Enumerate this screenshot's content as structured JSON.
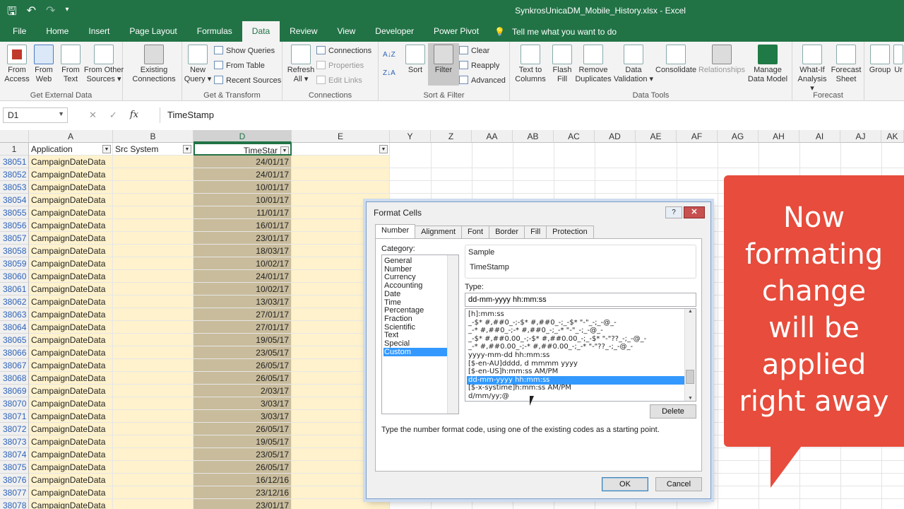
{
  "window": {
    "title": "SynkrosUnicaDM_Mobile_History.xlsx  -  Excel"
  },
  "menu": {
    "tabs": [
      "File",
      "Home",
      "Insert",
      "Page Layout",
      "Formulas",
      "Data",
      "Review",
      "View",
      "Developer",
      "Power Pivot"
    ],
    "active": "Data",
    "tell_me": "Tell me what you want to do"
  },
  "ribbon": {
    "get_external": {
      "label": "Get External Data",
      "from_access": [
        "From",
        "Access"
      ],
      "from_web": [
        "From",
        "Web"
      ],
      "from_text": [
        "From",
        "Text"
      ],
      "from_other": [
        "From Other",
        "Sources ▾"
      ],
      "existing": [
        "Existing",
        "Connections"
      ]
    },
    "get_transform": {
      "label": "Get & Transform",
      "new_query": [
        "New",
        "Query ▾"
      ],
      "show_queries": "Show Queries",
      "from_table": "From Table",
      "recent_sources": "Recent Sources"
    },
    "connections": {
      "label": "Connections",
      "refresh": [
        "Refresh",
        "All ▾"
      ],
      "connections": "Connections",
      "properties": "Properties",
      "edit_links": "Edit Links"
    },
    "sort_filter": {
      "label": "Sort & Filter",
      "sort": "Sort",
      "filter": "Filter",
      "clear": "Clear",
      "reapply": "Reapply",
      "advanced": "Advanced"
    },
    "data_tools": {
      "label": "Data Tools",
      "text_to_columns": [
        "Text to",
        "Columns"
      ],
      "flash_fill": [
        "Flash",
        "Fill"
      ],
      "remove_duplicates": [
        "Remove",
        "Duplicates"
      ],
      "data_validation": [
        "Data",
        "Validation ▾"
      ],
      "consolidate": "Consolidate",
      "relationships": "Relationships",
      "manage_data_model": [
        "Manage",
        "Data Model"
      ]
    },
    "forecast": {
      "label": "Forecast",
      "what_if": [
        "What-If",
        "Analysis ▾"
      ],
      "forecast_sheet": [
        "Forecast",
        "Sheet"
      ]
    },
    "outline": {
      "group": "Group",
      "ungroup": "Ur"
    }
  },
  "formula_bar": {
    "name_box": "D1",
    "fx": "fx",
    "content": "TimeStamp"
  },
  "grid": {
    "columns": [
      "A",
      "B",
      "D",
      "E",
      "Y",
      "Z",
      "AA",
      "AB",
      "AC",
      "AD",
      "AE",
      "AF",
      "AG",
      "AH",
      "AI",
      "AJ",
      "AK"
    ],
    "header_row": {
      "num": "1",
      "A": "Application",
      "B": "Src System",
      "D": "TimeStar",
      "E": ""
    },
    "rows": [
      {
        "num": "38051",
        "app": "CampaignDateData",
        "date": "24/01/17"
      },
      {
        "num": "38052",
        "app": "CampaignDateData",
        "date": "24/01/17"
      },
      {
        "num": "38053",
        "app": "CampaignDateData",
        "date": "10/01/17"
      },
      {
        "num": "38054",
        "app": "CampaignDateData",
        "date": "10/01/17"
      },
      {
        "num": "38055",
        "app": "CampaignDateData",
        "date": "11/01/17"
      },
      {
        "num": "38056",
        "app": "CampaignDateData",
        "date": "16/01/17"
      },
      {
        "num": "38057",
        "app": "CampaignDateData",
        "date": "23/01/17"
      },
      {
        "num": "38058",
        "app": "CampaignDateData",
        "date": "18/03/17"
      },
      {
        "num": "38059",
        "app": "CampaignDateData",
        "date": "10/02/17"
      },
      {
        "num": "38060",
        "app": "CampaignDateData",
        "date": "24/01/17"
      },
      {
        "num": "38061",
        "app": "CampaignDateData",
        "date": "10/02/17"
      },
      {
        "num": "38062",
        "app": "CampaignDateData",
        "date": "13/03/17"
      },
      {
        "num": "38063",
        "app": "CampaignDateData",
        "date": "27/01/17"
      },
      {
        "num": "38064",
        "app": "CampaignDateData",
        "date": "27/01/17"
      },
      {
        "num": "38065",
        "app": "CampaignDateData",
        "date": "19/05/17"
      },
      {
        "num": "38066",
        "app": "CampaignDateData",
        "date": "23/05/17"
      },
      {
        "num": "38067",
        "app": "CampaignDateData",
        "date": "26/05/17"
      },
      {
        "num": "38068",
        "app": "CampaignDateData",
        "date": "26/05/17"
      },
      {
        "num": "38069",
        "app": "CampaignDateData",
        "date": "2/03/17"
      },
      {
        "num": "38070",
        "app": "CampaignDateData",
        "date": "3/03/17"
      },
      {
        "num": "38071",
        "app": "CampaignDateData",
        "date": "3/03/17"
      },
      {
        "num": "38072",
        "app": "CampaignDateData",
        "date": "26/05/17"
      },
      {
        "num": "38073",
        "app": "CampaignDateData",
        "date": "19/05/17"
      },
      {
        "num": "38074",
        "app": "CampaignDateData",
        "date": "23/05/17"
      },
      {
        "num": "38075",
        "app": "CampaignDateData",
        "date": "26/05/17"
      },
      {
        "num": "38076",
        "app": "CampaignDateData",
        "date": "16/12/16"
      },
      {
        "num": "38077",
        "app": "CampaignDateData",
        "date": "23/12/16"
      },
      {
        "num": "38078",
        "app": "CampaignDateData",
        "date": "23/01/17"
      }
    ]
  },
  "dialog": {
    "title": "Format Cells",
    "help": "?",
    "close": "✕",
    "tabs": [
      "Number",
      "Alignment",
      "Font",
      "Border",
      "Fill",
      "Protection"
    ],
    "active_tab": "Number",
    "category_label": "Category:",
    "categories": [
      "General",
      "Number",
      "Currency",
      "Accounting",
      "Date",
      "Time",
      "Percentage",
      "Fraction",
      "Scientific",
      "Text",
      "Special",
      "Custom"
    ],
    "selected_category": "Custom",
    "sample_label": "Sample",
    "sample_value": "TimeStamp",
    "type_label": "Type:",
    "type_value": "dd-mm-yyyy hh:mm:ss",
    "type_list": [
      "[h]:mm:ss",
      "_-$* #,##0_-;-$* #,##0_-;_-$* \"-\"_-;_-@_-",
      "_-* #,##0_-;-* #,##0_-;_-* \"-\"_-;_-@_-",
      "_-$* #,##0.00_-;-$* #,##0.00_-;_-$* \"-\"??_-;_-@_-",
      "_-* #,##0.00_-;-* #,##0.00_-;_-* \"-\"??_-;_-@_-",
      "yyyy-mm-dd hh:mm:ss",
      "[$-en-AU]dddd, d mmmm yyyy",
      "[$-en-US]h:mm:ss AM/PM",
      "dd-mm-yyyy hh:mm:ss",
      "[$-x-systime]h:mm:ss AM/PM",
      "d/mm/yy;@"
    ],
    "selected_type_index": 8,
    "delete": "Delete",
    "hint": "Type the number format code, using one of the existing codes as a starting point.",
    "ok": "OK",
    "cancel": "Cancel"
  },
  "callout": {
    "lines": [
      "Now",
      "formating",
      "change",
      "will be",
      "applied",
      "right away"
    ],
    "color": "#e74c3c"
  },
  "colors": {
    "excel_green": "#217346",
    "cell_yellow": "#fff2cc",
    "cell_tan": "#c9bc9c"
  }
}
